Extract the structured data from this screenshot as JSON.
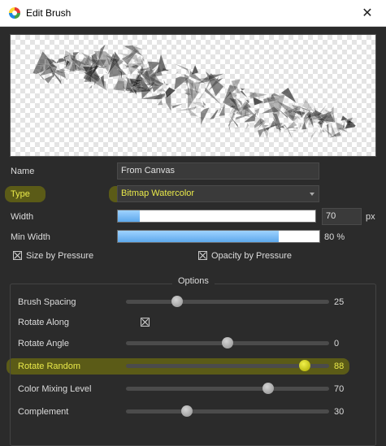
{
  "window": {
    "title": "Edit Brush",
    "close_glyph": "✕",
    "app_icon": "rebelle-app-icon"
  },
  "preview": {
    "image": "brush-stroke-preview"
  },
  "name": {
    "label": "Name",
    "value": "From Canvas"
  },
  "type": {
    "label": "Type",
    "value": "Bitmap Watercolor"
  },
  "width": {
    "label": "Width",
    "value": "70",
    "unit": "px",
    "level": 0.11
  },
  "min_width": {
    "label": "Min Width",
    "value": "80",
    "unit": "%",
    "level": 0.8
  },
  "size_by_pressure": {
    "label": "Size by Pressure",
    "checked": true
  },
  "opacity_by_pressure": {
    "label": "Opacity by Pressure",
    "checked": true
  },
  "options": {
    "title": "Options",
    "brush_spacing": {
      "label": "Brush Spacing",
      "value": "25",
      "level": 0.25
    },
    "rotate_along": {
      "label": "Rotate Along",
      "checked": true
    },
    "rotate_angle": {
      "label": "Rotate Angle",
      "value": "0",
      "level": 0.5
    },
    "rotate_random": {
      "label": "Rotate Random",
      "value": "88",
      "level": 0.88
    },
    "color_mixing_level": {
      "label": "Color Mixing Level",
      "value": "70",
      "level": 0.7
    },
    "complement": {
      "label": "Complement",
      "value": "30",
      "level": 0.3
    }
  },
  "colors": {
    "highlight": "#9a9a00",
    "accent_fill": "#5ea9ec",
    "background": "#2b2b2b"
  }
}
